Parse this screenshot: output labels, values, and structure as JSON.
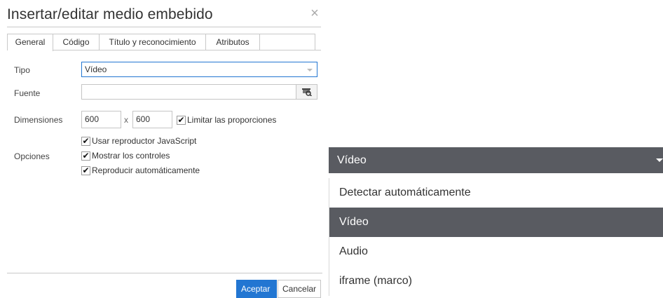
{
  "dialog": {
    "title": "Insertar/editar medio embebido",
    "close_label": "×",
    "tabs": [
      {
        "label": "General",
        "active": true
      },
      {
        "label": "Código",
        "active": false
      },
      {
        "label": "Título y reconocimiento",
        "active": false
      },
      {
        "label": "Atributos",
        "active": false
      }
    ],
    "fields": {
      "tipo_label": "Tipo",
      "tipo_value": "Vídeo",
      "fuente_label": "Fuente",
      "fuente_value": "",
      "dimensiones_label": "Dimensiones",
      "width_value": "600",
      "x_separator": "x",
      "height_value": "600",
      "limitar_label": "Limitar las proporciones",
      "opciones_label": "Opciones"
    },
    "options": [
      {
        "label": "Usar reproductor JavaScript",
        "checked": true
      },
      {
        "label": "Mostrar los controles",
        "checked": true
      },
      {
        "label": "Reproducir automáticamente",
        "checked": true
      }
    ],
    "buttons": {
      "accept": "Aceptar",
      "cancel": "Cancelar"
    },
    "accent_color": "#2276d2",
    "check_mark": "✔"
  },
  "dropdown": {
    "header": "Vídeo",
    "items": [
      {
        "label": "Detectar automáticamente",
        "selected": false
      },
      {
        "label": "Vídeo",
        "selected": true
      },
      {
        "label": "Audio",
        "selected": false
      },
      {
        "label": "iframe (marco)",
        "selected": false
      }
    ],
    "highlight_color": "#595b61"
  }
}
